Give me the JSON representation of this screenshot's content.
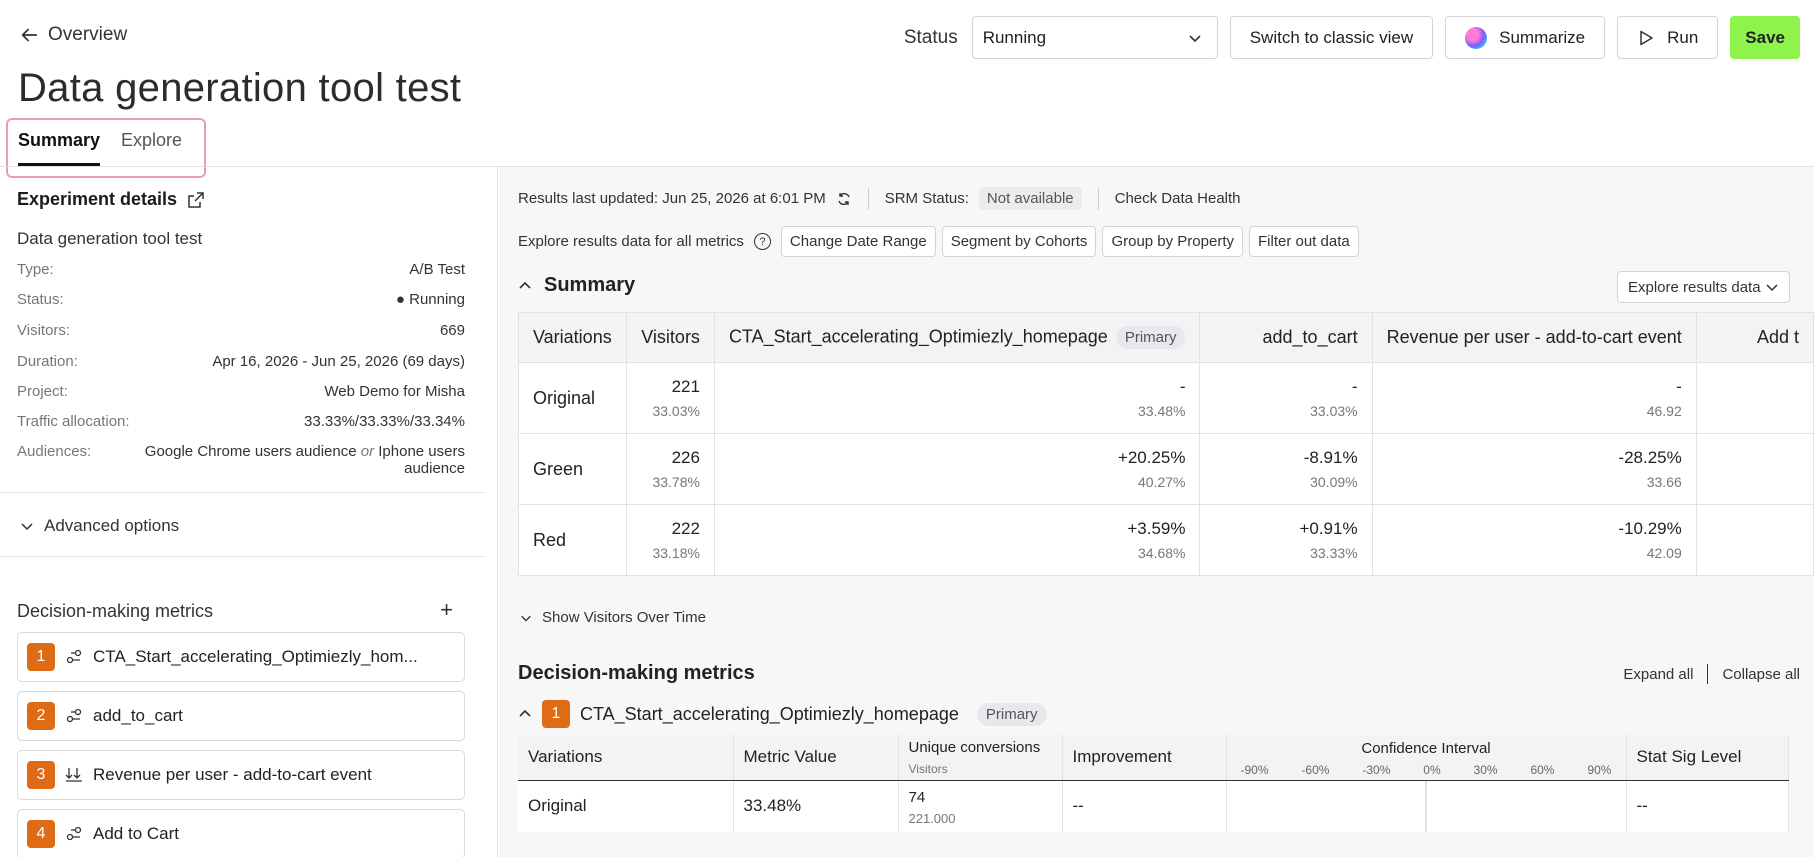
{
  "header": {
    "back_label": "Overview",
    "title": "Data generation tool test",
    "status_label": "Status",
    "status_value": "Running",
    "classic_view_label": "Switch to classic view",
    "summarize_label": "Summarize",
    "run_label": "Run",
    "save_label": "Save"
  },
  "tabs": [
    {
      "label": "Summary",
      "active": true
    },
    {
      "label": "Explore",
      "active": false
    }
  ],
  "sidebar": {
    "details_heading": "Experiment details",
    "experiment_name": "Data generation tool test",
    "details": [
      {
        "key": "Type:",
        "value": "A/B Test"
      },
      {
        "key": "Status:",
        "value": "● Running"
      },
      {
        "key": "Visitors:",
        "value": "669"
      },
      {
        "key": "Duration:",
        "value": "Apr 16, 2026 - Jun 25, 2026 (69 days)"
      },
      {
        "key": "Project:",
        "value": "Web Demo for Misha"
      },
      {
        "key": "Traffic allocation:",
        "value": "33.33%/33.33%/33.34%"
      }
    ],
    "audiences_key": "Audiences:",
    "audiences_a": "Google Chrome users audience",
    "audiences_or": "or",
    "audiences_b": "Iphone users",
    "audiences_c": "audience",
    "advanced_label": "Advanced options",
    "dm_heading": "Decision-making metrics",
    "dm_add": "+",
    "metrics": [
      {
        "num": "1",
        "name": "CTA_Start_accelerating_Optimiezly_hom..."
      },
      {
        "num": "2",
        "name": "add_to_cart"
      },
      {
        "num": "3",
        "name": "Revenue per user - add-to-cart event"
      },
      {
        "num": "4",
        "name": "Add to Cart"
      }
    ]
  },
  "results": {
    "updated": "Results last updated: Jun 25, 2026 at 6:01 PM",
    "srm_label": "SRM Status:",
    "srm_value": "Not available",
    "check_health": "Check Data Health",
    "explore_text": "Explore results data for all metrics",
    "pills": [
      "Change Date Range",
      "Segment by Cohorts",
      "Group by Property",
      "Filter out data"
    ],
    "summary_heading": "Summary",
    "explore_dropdown": "Explore results data",
    "summary_table": {
      "headers": [
        "Variations",
        "Visitors",
        "CTA_Start_accelerating_Optimiezly_homepage",
        "add_to_cart",
        "Revenue per user - add-to-cart event",
        "Add t"
      ],
      "primary_badge": "Primary",
      "rows": [
        {
          "name": "Original",
          "visitors": "221",
          "visitors_pct": "33.03%",
          "c1": "-",
          "c1s": "33.48%",
          "c2": "-",
          "c2s": "33.03%",
          "c3": "-",
          "c3s": "46.92"
        },
        {
          "name": "Green",
          "visitors": "226",
          "visitors_pct": "33.78%",
          "c1": "+20.25%",
          "c1s": "40.27%",
          "c2": "-8.91%",
          "c2s": "30.09%",
          "c3": "-28.25%",
          "c3s": "33.66"
        },
        {
          "name": "Red",
          "visitors": "222",
          "visitors_pct": "33.18%",
          "c1": "+3.59%",
          "c1s": "34.68%",
          "c2": "+0.91%",
          "c2s": "33.33%",
          "c3": "-10.29%",
          "c3s": "42.09"
        }
      ]
    },
    "show_visitors": "Show Visitors Over Time",
    "dm_heading": "Decision-making metrics",
    "expand_all": "Expand all",
    "collapse_all": "Collapse all",
    "metric1_num": "1",
    "metric1_name": "CTA_Start_accelerating_Optimiezly_homepage",
    "metric1_badge": "Primary",
    "dm_table": {
      "h_variations": "Variations",
      "h_metric_value": "Metric Value",
      "h_unique": "Unique conversions",
      "h_unique_sub": "Visitors",
      "h_improvement": "Improvement",
      "h_ci": "Confidence Interval",
      "ci_ticks": [
        "-90%",
        "-60%",
        "-30%",
        "0%",
        "30%",
        "60%",
        "90%"
      ],
      "h_stat_sig": "Stat Sig Level",
      "row": {
        "name": "Original",
        "metric_value": "33.48%",
        "conversions": "74",
        "visitors": "221.000",
        "improvement": "--",
        "stat_sig": "--"
      }
    }
  }
}
